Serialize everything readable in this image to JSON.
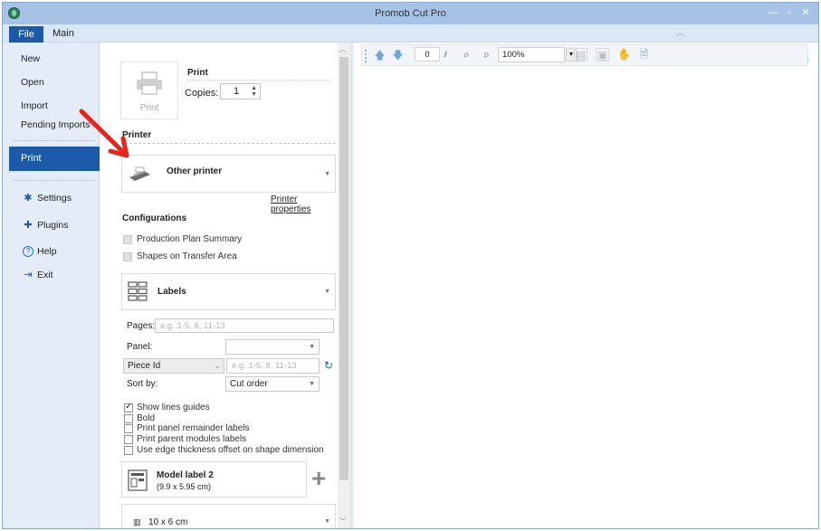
{
  "window": {
    "title": "Promob Cut Pro"
  },
  "ribbon": {
    "tabs": [
      {
        "label": "File"
      },
      {
        "label": "Main"
      }
    ]
  },
  "sidebar": {
    "items": [
      {
        "label": "New"
      },
      {
        "label": "Open"
      },
      {
        "label": "Import"
      },
      {
        "label": "Pending Imports"
      },
      {
        "label": "Print"
      },
      {
        "label": "Settings",
        "icon": "gear-icon"
      },
      {
        "label": "Plugins",
        "icon": "puzzle-icon"
      },
      {
        "label": "Help",
        "icon": "help-icon"
      },
      {
        "label": "Exit",
        "icon": "exit-icon"
      }
    ]
  },
  "print_panel": {
    "button_label": "Print",
    "heading": "Print",
    "copies_label": "Copies:",
    "copies_value": "1",
    "printer_section": "Printer",
    "printer_name": "Other printer",
    "printer_properties_link": "Printer properties",
    "configurations_section": "Configurations",
    "config_options": [
      {
        "label": "Production Plan Summary",
        "checked": false,
        "enabled": false
      },
      {
        "label": "Shapes on Transfer Area",
        "checked": false,
        "enabled": false
      }
    ],
    "report_type": "Labels",
    "pages_label": "Pages:",
    "pages_placeholder": "e.g. 1-5, 8, 11-13",
    "panel_label": "Panel:",
    "panel_value": "",
    "filter_field": "Piece Id",
    "filter_placeholder": "e.g. 1-5, 8, 11-13",
    "sort_label": "Sort by:",
    "sort_value": "Cut order",
    "options": [
      {
        "label": "Show lines guides",
        "checked": true
      },
      {
        "label": "Bold",
        "checked": false
      },
      {
        "label": "Print panel remainder labels",
        "checked": false
      },
      {
        "label": "Print parent modules labels",
        "checked": false
      },
      {
        "label": "Use edge thickness offset on shape dimension",
        "checked": false
      }
    ],
    "label_model": {
      "name": "Model label 2",
      "size": "(9.9 x 5.95 cm)"
    },
    "label_size": "10 x 6 cm"
  },
  "preview_toolbar": {
    "page_value": "0",
    "page_separator": "/",
    "zoom_value": "100%"
  },
  "colors": {
    "accent": "#1b5aa8",
    "titlebar": "#a6c2e4",
    "annotation_arrow": "#e8231a"
  }
}
